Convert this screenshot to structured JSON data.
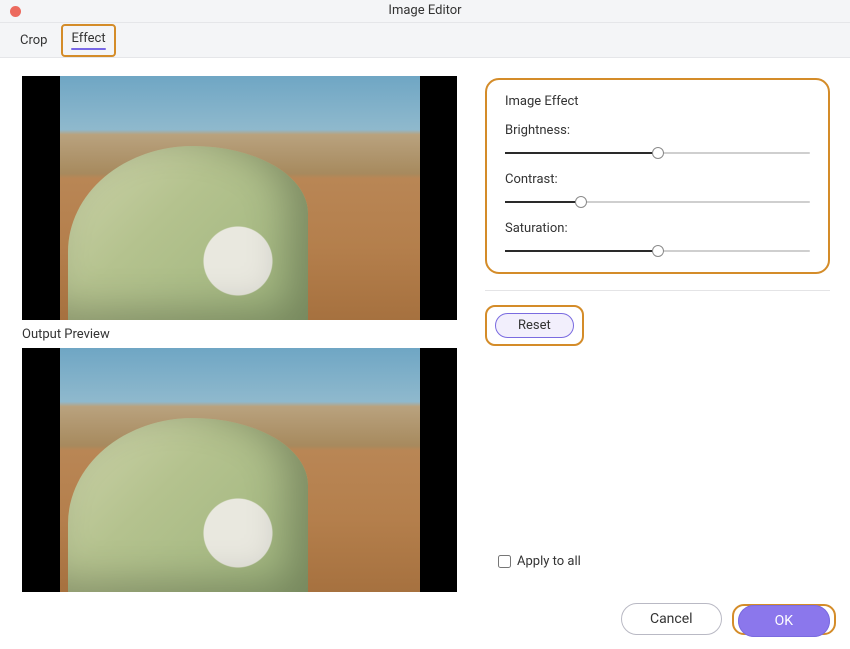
{
  "window": {
    "title": "Image Editor"
  },
  "tabs": {
    "crop": "Crop",
    "effect": "Effect",
    "active": "effect"
  },
  "left": {
    "outputPreviewLabel": "Output Preview"
  },
  "panel": {
    "title": "Image Effect",
    "brightness": {
      "label": "Brightness:",
      "value": 50,
      "min": 0,
      "max": 100
    },
    "contrast": {
      "label": "Contrast:",
      "value": 25,
      "min": 0,
      "max": 100
    },
    "saturation": {
      "label": "Saturation:",
      "value": 50,
      "min": 0,
      "max": 100
    }
  },
  "buttons": {
    "reset": "Reset",
    "cancel": "Cancel",
    "ok": "OK"
  },
  "applyAll": {
    "label": "Apply to all",
    "checked": false
  },
  "colors": {
    "highlight": "#d48c29",
    "accent": "#8b77ec"
  }
}
